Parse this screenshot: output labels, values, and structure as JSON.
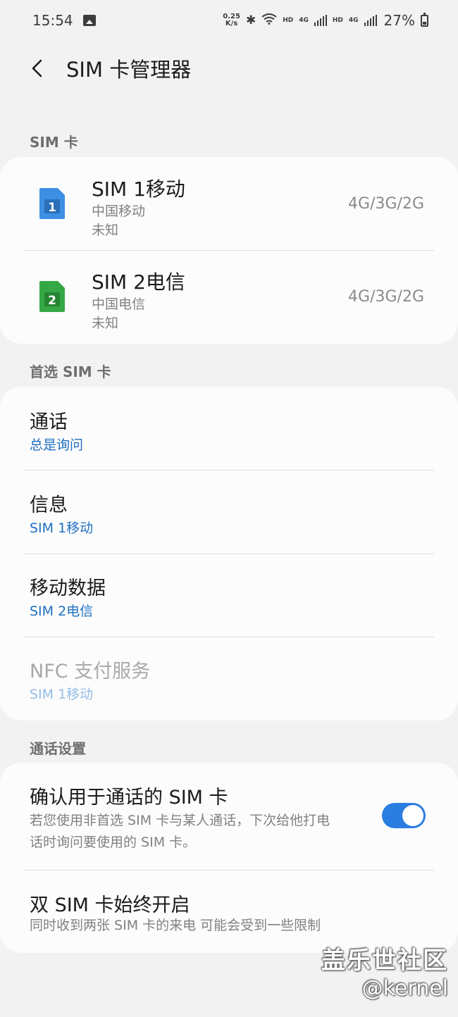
{
  "status_bar": {
    "time": "15:54",
    "net_speed_value": "0.25",
    "net_speed_unit": "K/s",
    "hd1": "HD",
    "lte1": "4G",
    "hd2": "HD",
    "lte2": "4G",
    "battery": "27%",
    "icons": [
      "image-icon",
      "bluetooth-icon",
      "wifi-icon",
      "signal-icon",
      "signal-icon",
      "battery-icon"
    ]
  },
  "app_bar": {
    "title": "SIM 卡管理器"
  },
  "sim_section": {
    "header": "SIM 卡",
    "cards": [
      {
        "slot": "1",
        "name": "SIM 1移动",
        "carrier": "中国移动",
        "number": "未知",
        "network": "4G/3G/2G",
        "color": "#3d8fe3"
      },
      {
        "slot": "2",
        "name": "SIM 2电信",
        "carrier": "中国电信",
        "number": "未知",
        "network": "4G/3G/2G",
        "color": "#35a845"
      }
    ]
  },
  "preferred_section": {
    "header": "首选 SIM 卡",
    "items": [
      {
        "title": "通话",
        "value": "总是询问"
      },
      {
        "title": "信息",
        "value": "SIM 1移动"
      },
      {
        "title": "移动数据",
        "value": "SIM 2电信"
      },
      {
        "title": "NFC 支付服务",
        "value": "SIM 1移动"
      }
    ]
  },
  "call_section": {
    "header": "通话设置",
    "confirm": {
      "title": "确认用于通话的 SIM 卡",
      "desc_line1": "若您使用非首选 SIM 卡与某人通话，下次给他打电",
      "desc_line2": "话时询问要使用的 SIM 卡。",
      "enabled": true
    },
    "dual": {
      "title": "双 SIM 卡始终开启",
      "desc": "同时收到两张 SIM 卡的来电 可能会受到一些限制"
    }
  },
  "watermark": {
    "line1": "盖乐世社区",
    "line2": "@kernel"
  },
  "colors": {
    "accent": "#2a7de1",
    "link": "#1f6fc1",
    "background": "#f2f2f2",
    "card": "#fcfcfc"
  }
}
